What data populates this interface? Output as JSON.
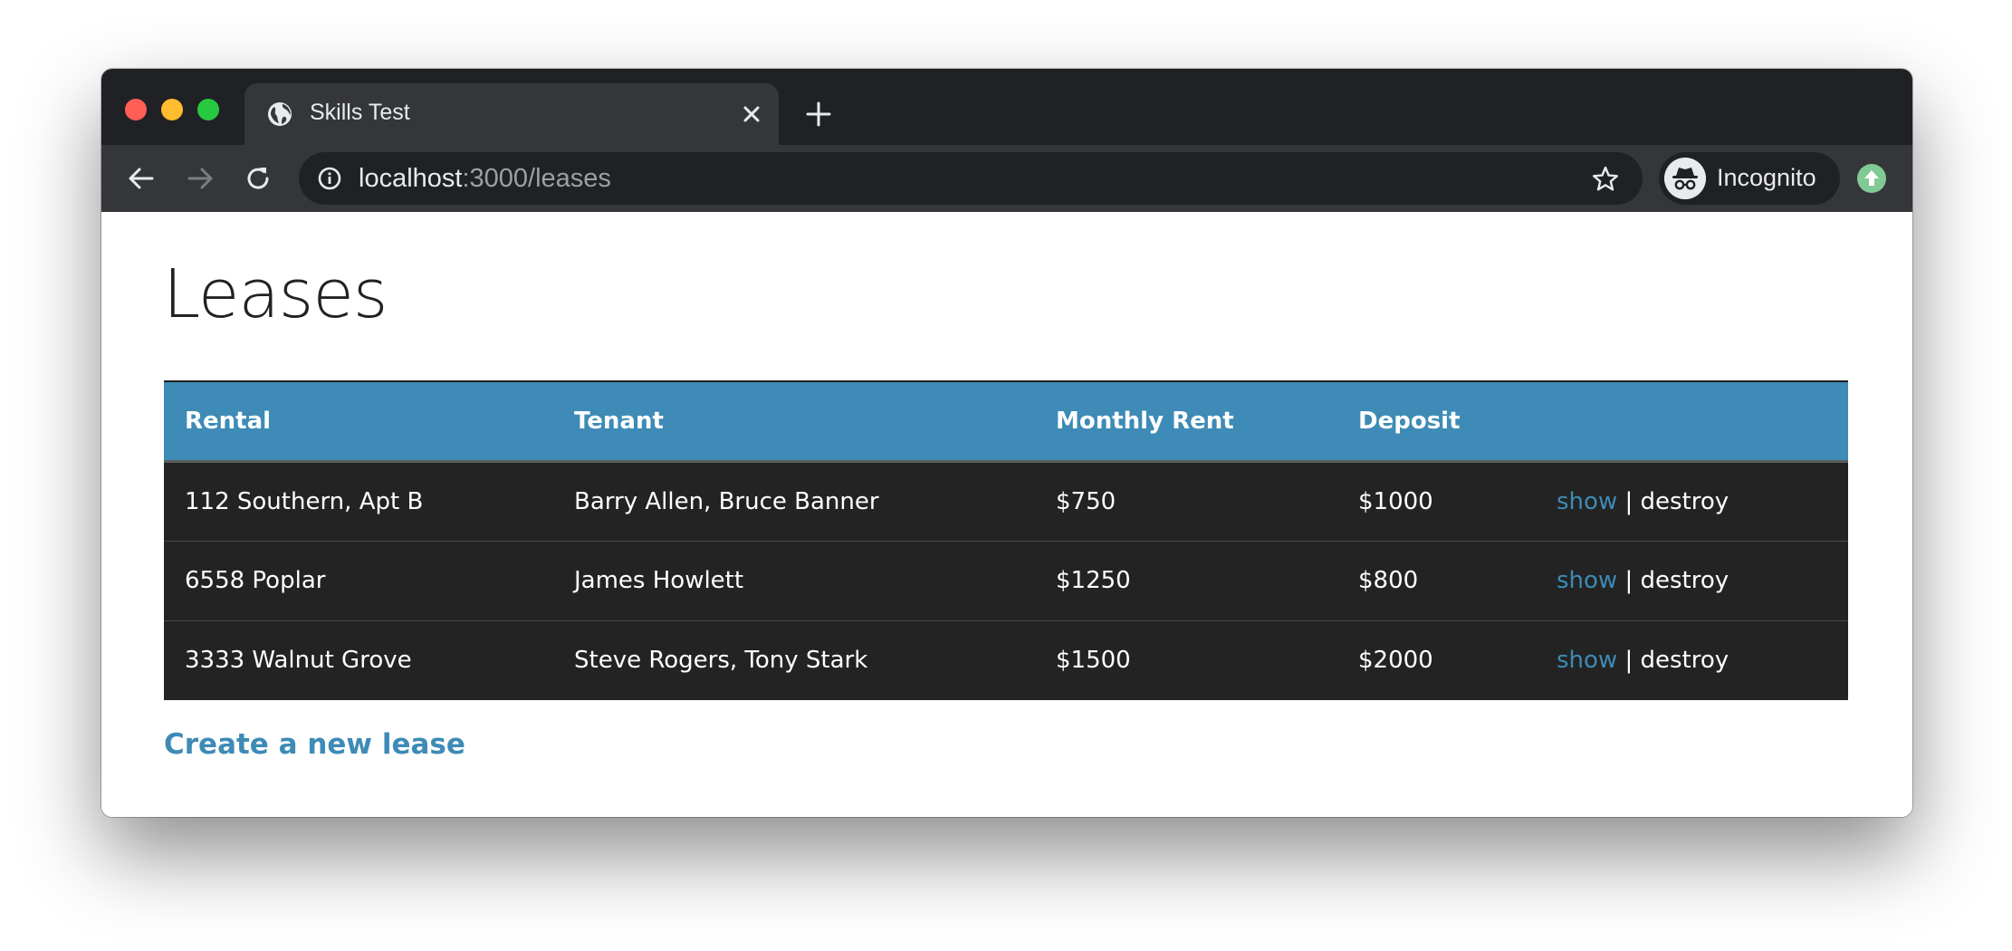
{
  "browser": {
    "tab": {
      "title": "Skills Test"
    },
    "url": {
      "host": "localhost",
      "path": ":3000/leases"
    },
    "profile": {
      "label": "Incognito"
    }
  },
  "page": {
    "title": "Leases",
    "create_link": "Create a new lease"
  },
  "table": {
    "columns": [
      "Rental",
      "Tenant",
      "Monthly Rent",
      "Deposit",
      ""
    ],
    "rows": [
      {
        "rental": "112 Southern, Apt B",
        "tenant": "Barry Allen, Bruce Banner",
        "rent": "$750",
        "deposit": "$1000",
        "show": "show",
        "sep": "|",
        "destroy": "destroy"
      },
      {
        "rental": "6558 Poplar",
        "tenant": "James Howlett",
        "rent": "$1250",
        "deposit": "$800",
        "show": "show",
        "sep": "|",
        "destroy": "destroy"
      },
      {
        "rental": "3333 Walnut Grove",
        "tenant": "Steve Rogers, Tony Stark",
        "rent": "$1500",
        "deposit": "$2000",
        "show": "show",
        "sep": "|",
        "destroy": "destroy"
      }
    ]
  },
  "colors": {
    "accent": "#3d8bb6",
    "table_body": "#232323",
    "browser_chrome": "#202124"
  },
  "icons": {
    "tab": "globe-icon",
    "close": "close-icon",
    "new_tab": "plus-icon",
    "back": "back-arrow-icon",
    "forward": "forward-arrow-icon",
    "reload": "reload-icon",
    "info": "info-icon",
    "bookmark": "star-icon",
    "profile": "incognito-icon",
    "update": "update-icon"
  }
}
